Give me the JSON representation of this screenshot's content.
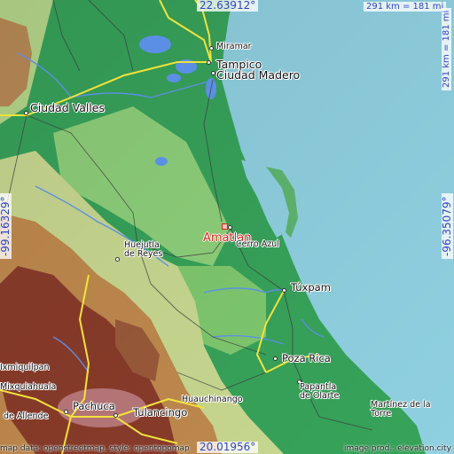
{
  "map": {
    "target": {
      "name": "Amatlan"
    },
    "coords": {
      "lat_top": "22.63912°",
      "lat_bottom": "20.01956°",
      "lon_left": "-99.16329°",
      "lon_right": "-96.35079°"
    },
    "scale": {
      "horizontal": "291 km = 181 mi",
      "vertical": "291 km = 181 mi"
    },
    "cities": [
      {
        "id": "miramar",
        "name": "Miramar"
      },
      {
        "id": "tampico",
        "name": "Tampico"
      },
      {
        "id": "ciudad-madero",
        "name": "Ciudad Madero"
      },
      {
        "id": "ciudad-valles",
        "name": "Ciudad Valles"
      },
      {
        "id": "huejutla",
        "name": "Huejutla de Reyes"
      },
      {
        "id": "cerro-azul",
        "name": "Cerro Azul"
      },
      {
        "id": "tuxpam",
        "name": "Túxpam"
      },
      {
        "id": "poza-rica",
        "name": "Poza Rica"
      },
      {
        "id": "papantla",
        "name": "Papantla de Olarte"
      },
      {
        "id": "ixmiquilpan",
        "name": "Ixmiquilpan"
      },
      {
        "id": "mixquiahuala",
        "name": "Mixquiahuala"
      },
      {
        "id": "huauchinango",
        "name": "Huauchinango"
      },
      {
        "id": "pachuca",
        "name": "Pachuca"
      },
      {
        "id": "tulancingo",
        "name": "Tulancingo"
      },
      {
        "id": "de-allende",
        "name": "de Allende"
      },
      {
        "id": "martinez",
        "name": "Martínez de la Torre"
      }
    ],
    "credits": {
      "left": "map data: openstreetmap, style: opentopomap",
      "right": "image prod.: elevation.city"
    },
    "colors": {
      "sea": "#8fd0e0",
      "lowland": "#37a35a",
      "plain": "#8ed07a",
      "hills": "#c9d990",
      "mountain": "#c08a4e",
      "peak": "#8a3c2a",
      "road_major": "#f3e23a",
      "road_minor": "#3a3a3a",
      "water": "#5b8fe6",
      "target": "#e02020",
      "coord_text": "#2f43c8"
    }
  }
}
